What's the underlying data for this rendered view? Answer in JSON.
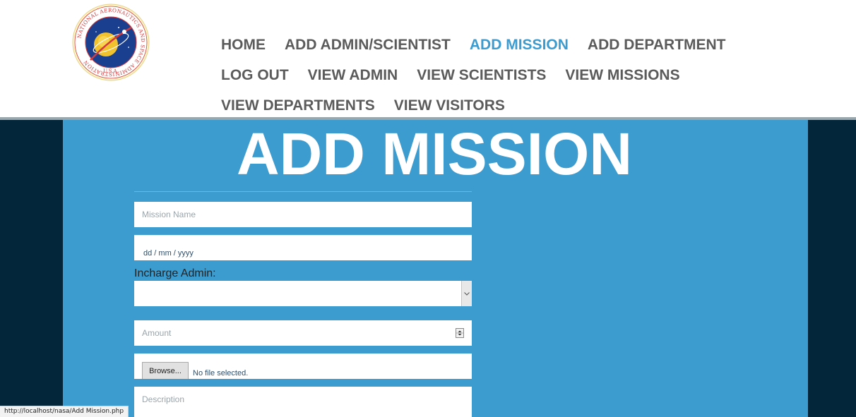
{
  "logo": {
    "name": "nasa-seal",
    "ring_text": "NATIONAL AERONAUTICS AND SPACE ADMINISTRATION",
    "bottom_text": "U.S.A."
  },
  "nav": {
    "rows": [
      [
        {
          "label": "HOME",
          "active": false
        },
        {
          "label": "ADD ADMIN/SCIENTIST",
          "active": false
        },
        {
          "label": "ADD MISSION",
          "active": true
        },
        {
          "label": "ADD DEPARTMENT",
          "active": false
        }
      ],
      [
        {
          "label": "LOG OUT",
          "active": false
        },
        {
          "label": "VIEW ADMIN",
          "active": false
        },
        {
          "label": "VIEW SCIENTISTS",
          "active": false
        },
        {
          "label": "VIEW MISSIONS",
          "active": false
        }
      ],
      [
        {
          "label": "VIEW DEPARTMENTS",
          "active": false
        },
        {
          "label": "VIEW VISITORS",
          "active": false
        }
      ]
    ]
  },
  "page": {
    "title": "ADD MISSION"
  },
  "form": {
    "mission_name_placeholder": "Mission Name",
    "date_value": "dd / mm / yyyy",
    "incharge_label": "Incharge Admin:",
    "incharge_selected": "",
    "amount_placeholder": "Amount",
    "browse_label": "Browse...",
    "file_status": "No file selected.",
    "description_placeholder": "Description"
  },
  "status_bar": {
    "url": "http://localhost/nasa/Add Mission.php"
  },
  "colors": {
    "accent": "#3c9ccf",
    "nav_text": "#5b5b5b",
    "dark_side": "#03263a",
    "title": "#ffffff"
  }
}
